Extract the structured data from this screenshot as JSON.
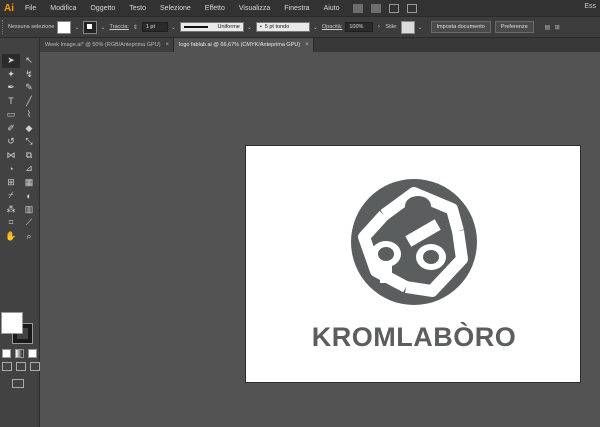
{
  "app": {
    "logo": "Ai"
  },
  "menu": [
    "File",
    "Modifica",
    "Oggetto",
    "Testo",
    "Selezione",
    "Effetto",
    "Visualizza",
    "Finestra",
    "Aiuto"
  ],
  "workspace": "Ess",
  "control": {
    "selection_label": "Nessuna selezione",
    "stroke_label": "Traccia:",
    "stroke_weight": "1 pt",
    "profile_label": "Uniforme",
    "brush_label": "5 pt tondo",
    "opacity_label": "Opacità:",
    "opacity_value": "100%",
    "style_label": "Stile:",
    "document_setup_label": "Imposta documento",
    "preferences_label": "Preferenze"
  },
  "tabs": [
    {
      "label": "Week Image.ai* @ 50% (RGB/Anteprima GPU)",
      "close": "×"
    },
    {
      "label": "logo fablab.ai @ 66,67% (CMYK/Anteprima GPU)",
      "close": "×"
    }
  ],
  "artwork": {
    "wordmark": "KROMLABÒRO",
    "logo_color": "#5b5e5f"
  },
  "icons": {
    "tools": [
      "selection-icon",
      "direct-selection-icon",
      "magic-wand-icon",
      "lasso-icon",
      "pen-icon",
      "curvature-icon",
      "type-icon",
      "line-icon",
      "rectangle-icon",
      "paintbrush-icon",
      "shaper-icon",
      "eraser-icon",
      "rotate-icon",
      "scale-icon",
      "width-icon",
      "free-transform-icon",
      "shape-builder-icon",
      "perspective-icon",
      "mesh-icon",
      "gradient-icon",
      "eyedropper-icon",
      "blend-icon",
      "symbol-sprayer-icon",
      "column-graph-icon",
      "artboard-icon",
      "slice-icon",
      "hand-icon",
      "zoom-icon"
    ]
  }
}
